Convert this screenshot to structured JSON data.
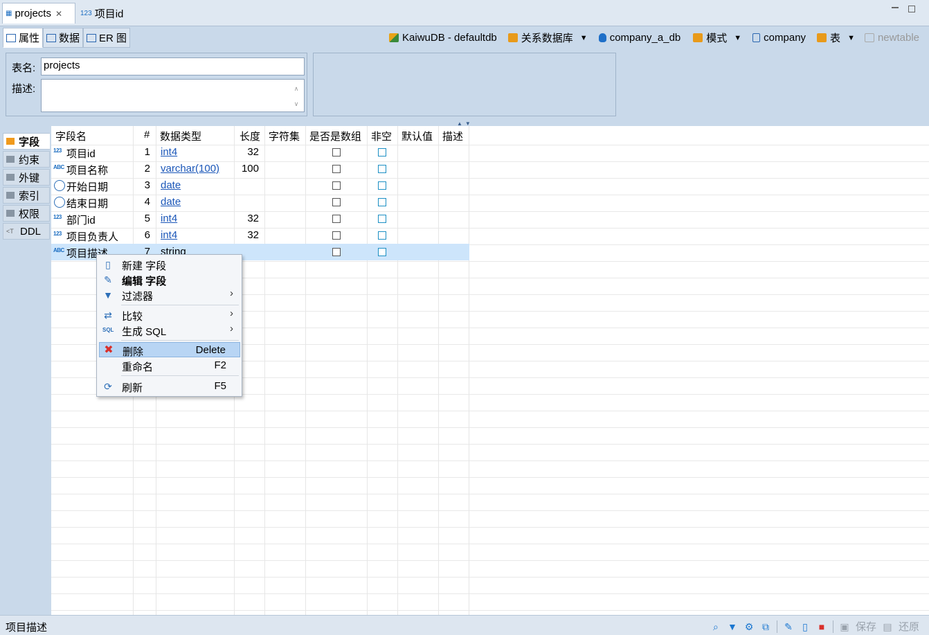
{
  "editor_tabs": [
    {
      "label": "projects",
      "close": "✕"
    },
    {
      "label": "项目id"
    }
  ],
  "sub_tabs": [
    "属性",
    "数据",
    "ER 图"
  ],
  "breadcrumb": {
    "connection": "KaiwuDB - defaultdb",
    "database_type": "关系数据库",
    "database": "company_a_db",
    "schema_type": "模式",
    "schema": "company",
    "object_type": "表",
    "new_table": "newtable"
  },
  "properties": {
    "table_name_label": "表名:",
    "table_name": "projects",
    "description_label": "描述:",
    "description": ""
  },
  "side_tabs": [
    "字段",
    "约束",
    "外键",
    "索引",
    "权限",
    "DDL"
  ],
  "grid": {
    "headers": [
      "字段名",
      "#",
      "数据类型",
      "长度",
      "字符集",
      "是否是数组",
      "非空",
      "默认值",
      "描述"
    ],
    "rows": [
      {
        "type_icon": "123",
        "name": "项目id",
        "num": "1",
        "dtype": "int4",
        "length": "32"
      },
      {
        "type_icon": "ABC",
        "name": "项目名称",
        "num": "2",
        "dtype": "varchar(100)",
        "length": "100"
      },
      {
        "type_icon": "date",
        "name": "开始日期",
        "num": "3",
        "dtype": "date",
        "length": ""
      },
      {
        "type_icon": "date",
        "name": "结束日期",
        "num": "4",
        "dtype": "date",
        "length": ""
      },
      {
        "type_icon": "123",
        "name": "部门id",
        "num": "5",
        "dtype": "int4",
        "length": "32"
      },
      {
        "type_icon": "123",
        "name": "项目负责人",
        "num": "6",
        "dtype": "int4",
        "length": "32"
      },
      {
        "type_icon": "ABC",
        "name": "项目描述",
        "num": "7",
        "dtype": "string",
        "length": ""
      }
    ]
  },
  "context_menu": {
    "new_field": "新建 字段",
    "edit_field": "编辑 字段",
    "filter": "过滤器",
    "compare": "比较",
    "generate_sql": "生成 SQL",
    "delete": "删除",
    "delete_key": "Delete",
    "rename": "重命名",
    "rename_key": "F2",
    "refresh": "刷新",
    "refresh_key": "F5"
  },
  "status": {
    "text": "项目描述",
    "save": "保存",
    "revert": "还原"
  },
  "colors": {
    "accent": "#1a56b8",
    "selection": "#cde5fb",
    "menu_highlight": "#b8d5f4",
    "delete_icon": "#d9302b"
  }
}
